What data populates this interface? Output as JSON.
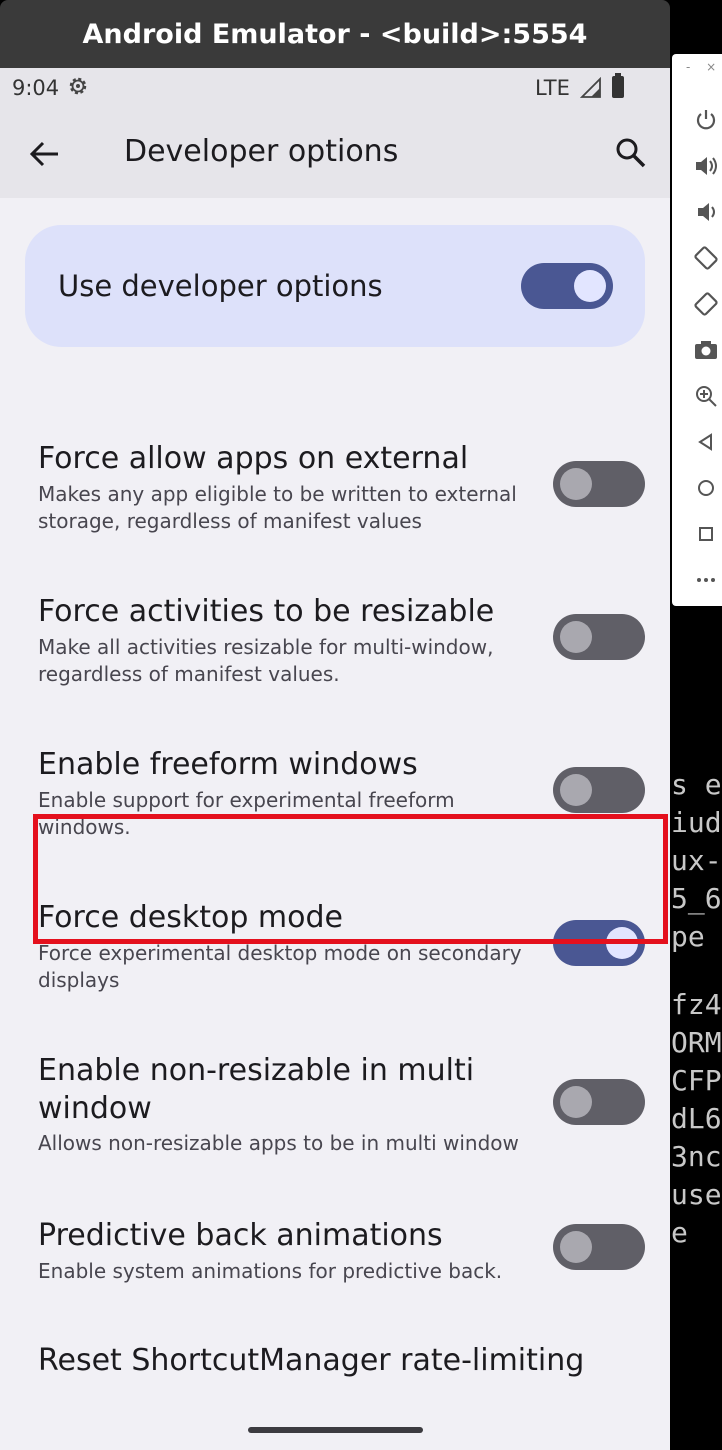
{
  "window": {
    "title": "Android Emulator - <build>:5554"
  },
  "status_bar": {
    "time": "9:04",
    "network": "LTE"
  },
  "app_bar": {
    "title": "Developer options"
  },
  "master_switch": {
    "label": "Use developer options",
    "on": true
  },
  "settings": [
    {
      "title": "Force allow apps on external",
      "subtitle": "Makes any app eligible to be written to external storage, regardless of manifest values",
      "on": false
    },
    {
      "title": "Force activities to be resizable",
      "subtitle": "Make all activities resizable for multi-window, regardless of manifest values.",
      "on": false
    },
    {
      "title": "Enable freeform windows",
      "subtitle": "Enable support for experimental freeform windows.",
      "on": false
    },
    {
      "title": "Force desktop mode",
      "subtitle": "Force experimental desktop mode on secondary displays",
      "on": true
    },
    {
      "title": "Enable non-resizable in multi window",
      "subtitle": "Allows non-resizable apps to be in multi window",
      "on": false
    },
    {
      "title": "Predictive back animations",
      "subtitle": "Enable system animations for predictive back.",
      "on": false
    },
    {
      "title": "Reset ShortcutManager rate-limiting"
    }
  ],
  "emulator_controls": [
    "power-icon",
    "volume-up-icon",
    "volume-down-icon",
    "rotate-left-icon",
    "rotate-right-icon",
    "camera-icon",
    "zoom-icon",
    "back-triangle-icon",
    "home-circle-icon",
    "overview-square-icon",
    "more-icon"
  ],
  "terminal_fragments": [
    "s e",
    "iud",
    "ux-",
    "5_6",
    "pe",
    "fz4",
    "ORM",
    "CFP",
    "dL6",
    "3nc",
    "use",
    "e"
  ],
  "colors": {
    "highlight": "#e4101d",
    "switch_on": "#4a5793",
    "switch_off": "#605f67",
    "master_bg": "#dde1fa"
  }
}
